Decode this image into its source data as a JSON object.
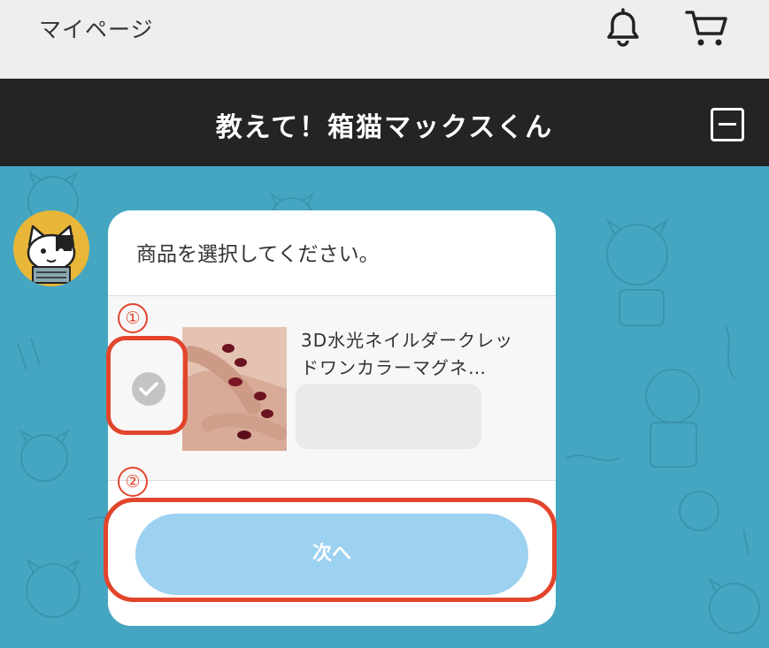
{
  "topbar": {
    "mypage_label": "マイページ",
    "icons": [
      "bell-icon",
      "cart-icon"
    ]
  },
  "chat": {
    "title": "教えて！箱猫マックスくん",
    "minimize_icon": "minimize-icon"
  },
  "card": {
    "prompt": "商品を選択してください。",
    "item": {
      "name": "3D水光ネイルダークレッドワンカラーマグネ…",
      "check_icon": "checkmark-icon",
      "selected": false
    },
    "next_button": "次へ"
  },
  "annotations": {
    "step1": "①",
    "step2": "②"
  },
  "colors": {
    "background": "#45a6c1",
    "header": "#242424",
    "button": "#9dd1f0",
    "annotation": "#e2452c"
  }
}
